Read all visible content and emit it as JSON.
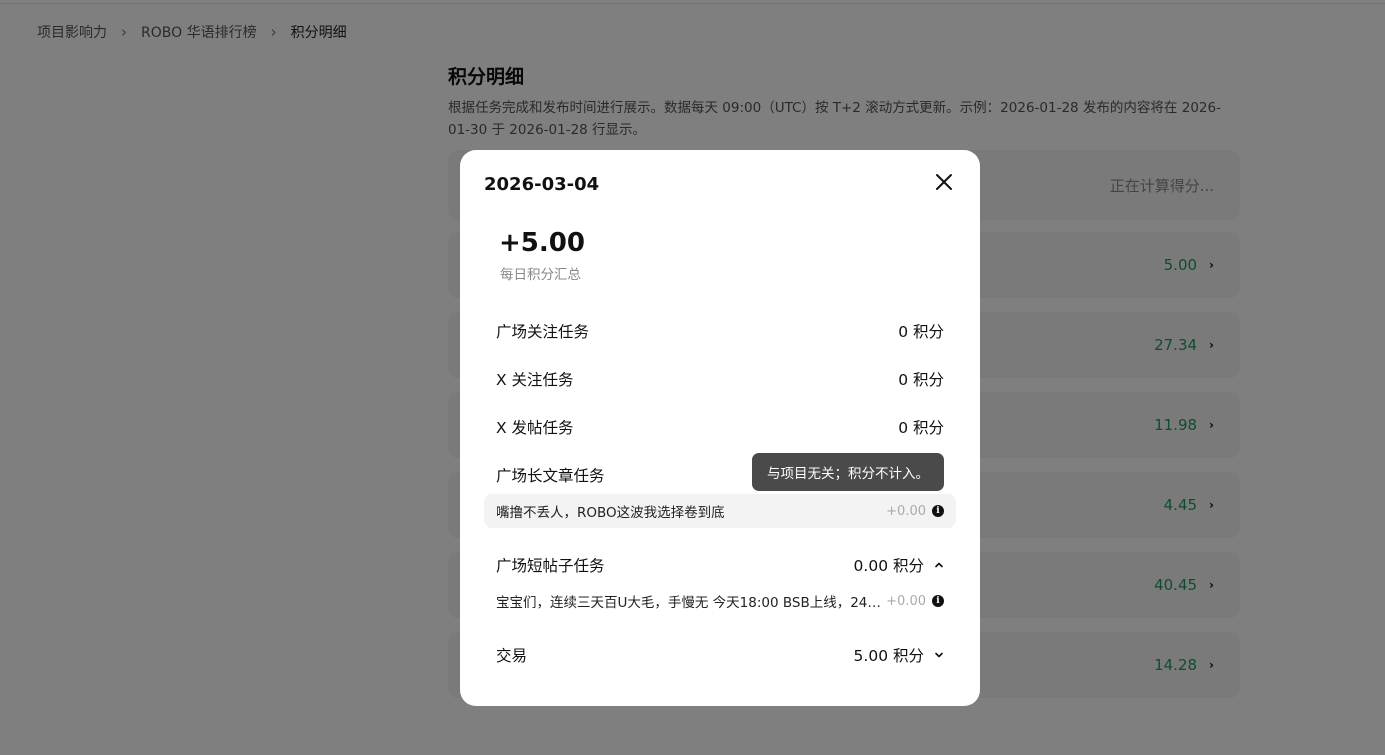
{
  "breadcrumb": {
    "items": [
      "项目影响力",
      "ROBO 华语排行榜",
      "积分明细"
    ],
    "separator": "›"
  },
  "page": {
    "title": "积分明细",
    "description": "根据任务完成和发布时间进行展示。数据每天 09:00（UTC）按 T+2 滚动方式更新。示例：2026-01-28 发布的内容将在 2026-01-30 于 2026-01-28 行显示。",
    "status_text": "正在计算得分...",
    "score_rows": [
      {
        "value": "5.00"
      },
      {
        "value": "27.34"
      },
      {
        "value": "11.98"
      },
      {
        "value": "4.45"
      },
      {
        "value": "40.45"
      },
      {
        "value": "14.28"
      }
    ]
  },
  "modal": {
    "date": "2026-03-04",
    "total": "+5.00",
    "total_label": "每日积分汇总",
    "tasks": [
      {
        "name": "广场关注任务",
        "points": "0 积分"
      },
      {
        "name": "X 关注任务",
        "points": "0 积分"
      },
      {
        "name": "X 发帖任务",
        "points": "0 积分"
      },
      {
        "name": "广场长文章任务",
        "points": ""
      },
      {
        "name": "广场短帖子任务",
        "points": "0.00 积分",
        "expanded": true
      },
      {
        "name": "交易",
        "points": "5.00 积分",
        "expanded": false
      }
    ],
    "long_article_item": {
      "text": "嘴撸不丢人，ROBO这波我选择卷到底",
      "value": "+0.00"
    },
    "short_post_item": {
      "text": "宝宝们，连续三天百U大毛，手慢无 今天18:00 BSB上线，246...",
      "value": "+0.00"
    },
    "tooltip": "与项目无关；积分不计入。"
  },
  "colors": {
    "positive": "#1e9b5c",
    "overlay": "rgba(0,0,0,0.5)",
    "tooltip_bg": "#4a4a4a"
  },
  "icons": [
    "chevron-right-icon",
    "close-icon",
    "chevron-up-icon",
    "chevron-down-icon",
    "info-icon"
  ]
}
